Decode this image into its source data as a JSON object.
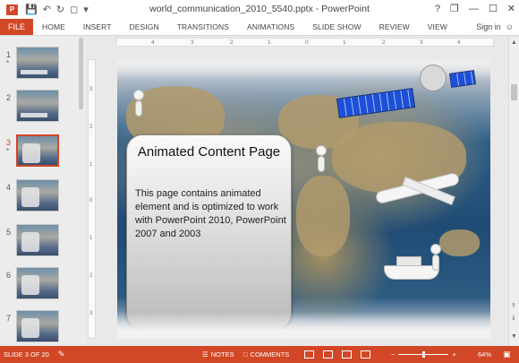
{
  "window": {
    "title": "world_communication_2010_5540.pptx - PowerPoint",
    "app_icon": "P",
    "qat": [
      "save-icon",
      "undo-icon",
      "redo-icon",
      "present-icon",
      "customize-icon"
    ],
    "controls": [
      "?",
      "❐",
      "—",
      "☐",
      "✕"
    ]
  },
  "ribbon": {
    "file_label": "FILE",
    "tabs": [
      "HOME",
      "INSERT",
      "DESIGN",
      "TRANSITIONS",
      "ANIMATIONS",
      "SLIDE SHOW",
      "REVIEW",
      "VIEW"
    ],
    "signin_label": "Sign in",
    "signin_icon": "smiley-icon"
  },
  "thumbnails": [
    {
      "number": "1",
      "star": "*"
    },
    {
      "number": "2",
      "star": ""
    },
    {
      "number": "3",
      "star": "*",
      "selected": true
    },
    {
      "number": "4",
      "star": ""
    },
    {
      "number": "5",
      "star": ""
    },
    {
      "number": "6",
      "star": ""
    },
    {
      "number": "7",
      "star": ""
    }
  ],
  "ruler": {
    "h_labels": [
      "4",
      "3",
      "2",
      "1",
      "0",
      "1",
      "2",
      "3",
      "4"
    ],
    "v_labels": [
      "3",
      "2",
      "1",
      "0",
      "1",
      "2",
      "3"
    ]
  },
  "slide": {
    "title": "Animated Content Page",
    "body": "This page contains animated element and is optimized to work with PowerPoint 2010, PowerPoint 2007 and 2003"
  },
  "statusbar": {
    "slide_indicator": "SLIDE 3 OF 20",
    "notes_label": "NOTES",
    "comments_label": "COMMENTS",
    "zoom_minus": "−",
    "zoom_plus": "+",
    "zoom_percent": "64%",
    "zoom_level": 0.5
  },
  "colors": {
    "accent": "#d24726",
    "background": "#e9e9e9"
  }
}
